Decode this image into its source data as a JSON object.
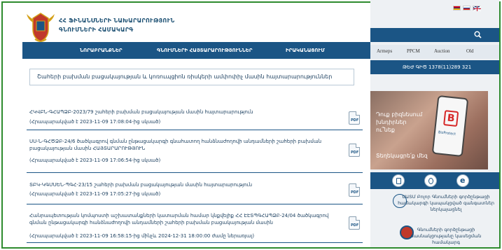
{
  "header": {
    "org_line1": "ՀՀ ՖԻՆԱՆՍՆԵՐԻ ՆԱԽԱՐԱՐՈՒԹՅՈՒՆ",
    "org_line2": "ԳՆՈՒՄՆԵՐԻ ՀԱՄԱԿԱՐԳ"
  },
  "nav": {
    "items": [
      "ՆՈՐԱԲՐԱՆՔՆԵՐ",
      "ԳՆՈՒՄՆԵՐԻ ՀԱՅՏԱՐԱՐՈՒԹՅՈՒՆՆԵՐ",
      "ԻՐԱԿԱՆԱՑՈՒՄ"
    ]
  },
  "page": {
    "title": "Շահերի բախման բացակայության և կոռուպցիոն ռիսկերի ամփոփիչ մասին հայտարարություններ"
  },
  "news": [
    {
      "title": "ՀԿՎԲՆ-ԳՀԱՊՁԲ-2023/79 շահերի բախման բացակայության մասին հայտարարություն",
      "date": "(Հրապարակված է 2023-11-09 17:08:04-ից սկսած)"
    },
    {
      "title": "ՍՍ-Ն-ԳՀԾՁԲ-24/6 ծածկագրով գնման ընթացակարգի գնահատող հանձնաժողովի անդամների շահերի բախման բացակայության մասին ՀԱՅՏԱՐԱՐՈՒԹՅՈՒՆ",
      "date": "(Հրապարակված է 2023-11-09 17:06:54-ից սկսած)"
    },
    {
      "title": "ՏԲԿ-ԿԳՄՍԵՆ-ՊԳՀ-23/15 շահերի բախման բացակայության մասին հայտարարություն",
      "date": "(Հրապարակված է 2023-11-09 17:05:27-ից սկսած)"
    },
    {
      "title": "Հանրապետության կոմպոստի աշխատանքների կատարման համար կնքվելիք ՀՀ ԷԷՏՊԳՀԱՊՁԲ-24/04 ծածկագրով գնման ընթացակարգի հանձնաժողովի անդամների շահերի բախման բացակայության մասին",
      "date": "(Հրապարակված է 2023-11-09 16:58:15-ից մինչև 2024-12-31 18:00:00 ժամը ներառյալ)"
    }
  ],
  "pdf_label": "PDF",
  "sidebar": {
    "tabs": [
      "Armeps",
      "PPCM",
      "Auction",
      "Old"
    ],
    "phone": "ԹԵԺ ԳԻԾ 1378(11)289 321",
    "banner_text1": "Դուք բիզնեսում խնդիրներ ու՞նեք",
    "banner_text2": "Տեղեկացրե՛ք մեզ",
    "banner_phone_label": "BizProtect",
    "banner_letter": "B",
    "items": [
      {
        "text": "ՍԱՏՄ Բոլոր Գնումների գործընթացի համակարգի կապակցված գանգատներ ներկայացնել"
      },
      {
        "text": "Գնումների գործընթացի մասնակցությանը կասեցման համակարգ"
      }
    ]
  },
  "colors": {
    "primary": "#1b5585",
    "text": "#1b3f5f",
    "frame": "#2e8b2e"
  },
  "icons": [
    "coat-of-arms-icon",
    "flag-am-icon",
    "flag-ru-icon",
    "flag-uk-icon",
    "search-icon",
    "pdf-icon",
    "document-icon",
    "list-icon",
    "e-icon"
  ]
}
